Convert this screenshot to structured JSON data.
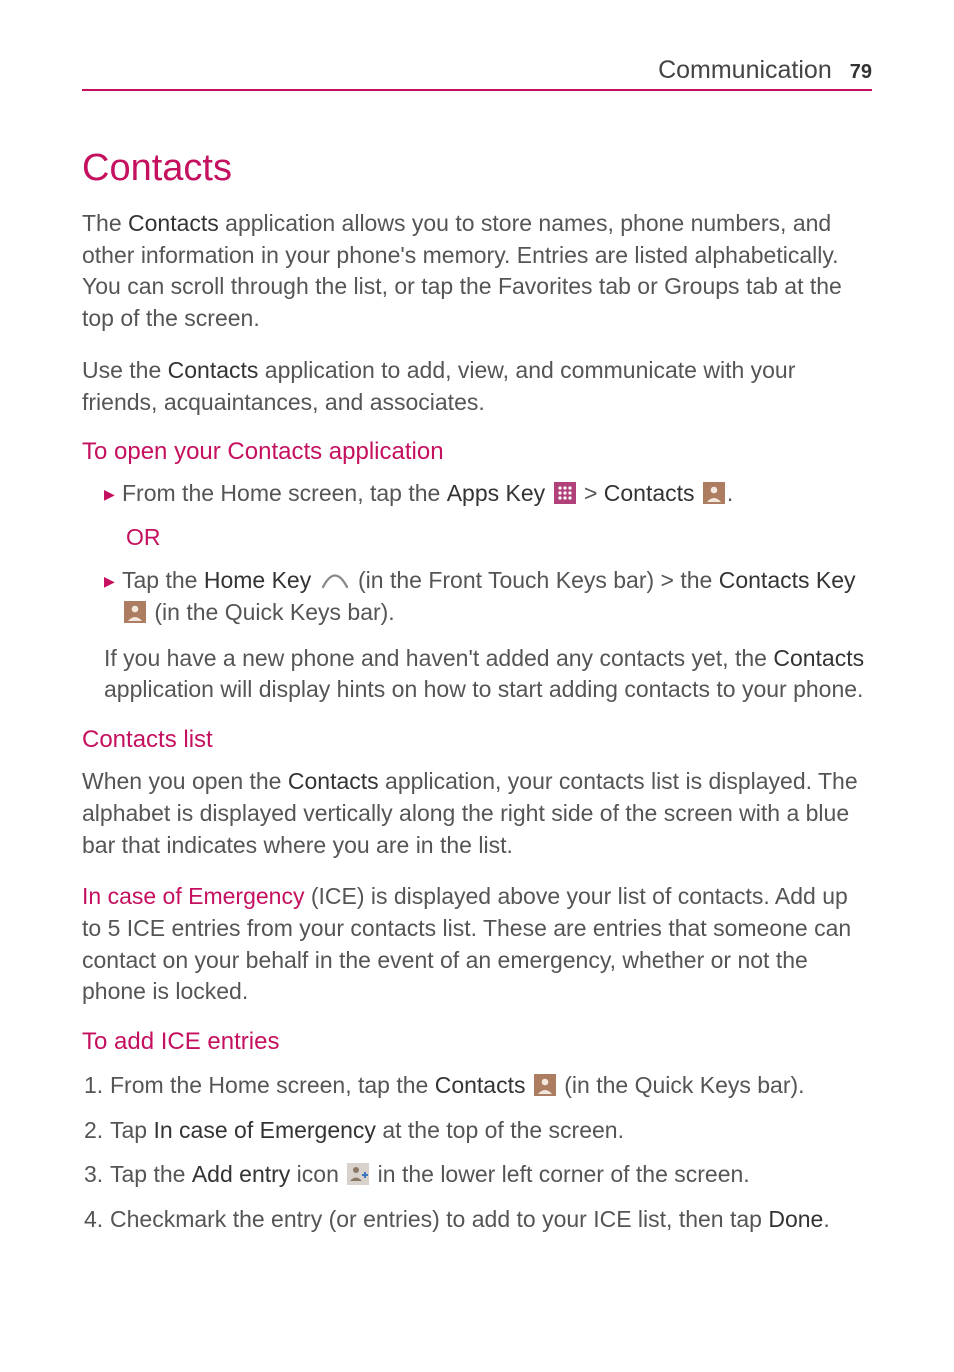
{
  "header": {
    "section": "Communication",
    "page_number": "79"
  },
  "title": "Contacts",
  "intro_p1_pre": "The ",
  "intro_p1_bold": "Contacts",
  "intro_p1_post": " application allows you to store names, phone numbers, and other information in your phone's memory. Entries are listed alphabetically. You can scroll through the list, or tap the Favorites tab or Groups tab at the top of the screen.",
  "intro_p2_pre": "Use the ",
  "intro_p2_bold": "Contacts",
  "intro_p2_post": " application to add, view, and communicate with your friends, acquaintances, and associates.",
  "section_open": {
    "heading": "To open your Contacts application",
    "bullet1_pre": "From the Home screen, tap the ",
    "bullet1_b1": "Apps Key",
    "bullet1_mid": " > ",
    "bullet1_b2": "Contacts",
    "bullet1_post": ".",
    "or_label": "OR",
    "bullet2_pre": "Tap the ",
    "bullet2_b1": "Home Key",
    "bullet2_mid1": " (in the Front Touch Keys bar) > the ",
    "bullet2_b2": "Contacts Key",
    "bullet2_post": " (in the Quick Keys bar).",
    "note_pre": "If you have a new phone and haven't added any contacts yet, the ",
    "note_bold": "Contacts",
    "note_post": " application will display hints on how to start adding contacts to your phone."
  },
  "section_list": {
    "heading": "Contacts list",
    "p1_pre": "When you open the ",
    "p1_bold": "Contacts",
    "p1_post": " application, your contacts list is displayed. The alphabet is displayed vertically along the right side of the screen with a blue bar that indicates where you are in the list.",
    "p2_pink": "In case of Emergency",
    "p2_post": " (ICE) is displayed above your list of contacts. Add up to 5 ICE entries from your contacts list. These are entries that someone can contact on your behalf in the event of an emergency, whether or not the phone is locked."
  },
  "section_ice": {
    "heading": "To add ICE entries",
    "steps": [
      {
        "num": "1.",
        "pre": " From the Home screen, tap the ",
        "b1": "Contacts",
        "post": " (in the Quick Keys bar)."
      },
      {
        "num": "2.",
        "pre": " Tap ",
        "b1": "In case of Emergency",
        "post": " at the top of the screen."
      },
      {
        "num": "3.",
        "pre": " Tap the ",
        "b1": "Add entry",
        "mid": " icon ",
        "post": " in the lower left corner of the screen."
      },
      {
        "num": "4.",
        "pre": " Checkmark the entry (or entries) to add to your ICE list, then tap ",
        "b1": "Done",
        "post": "."
      }
    ]
  }
}
